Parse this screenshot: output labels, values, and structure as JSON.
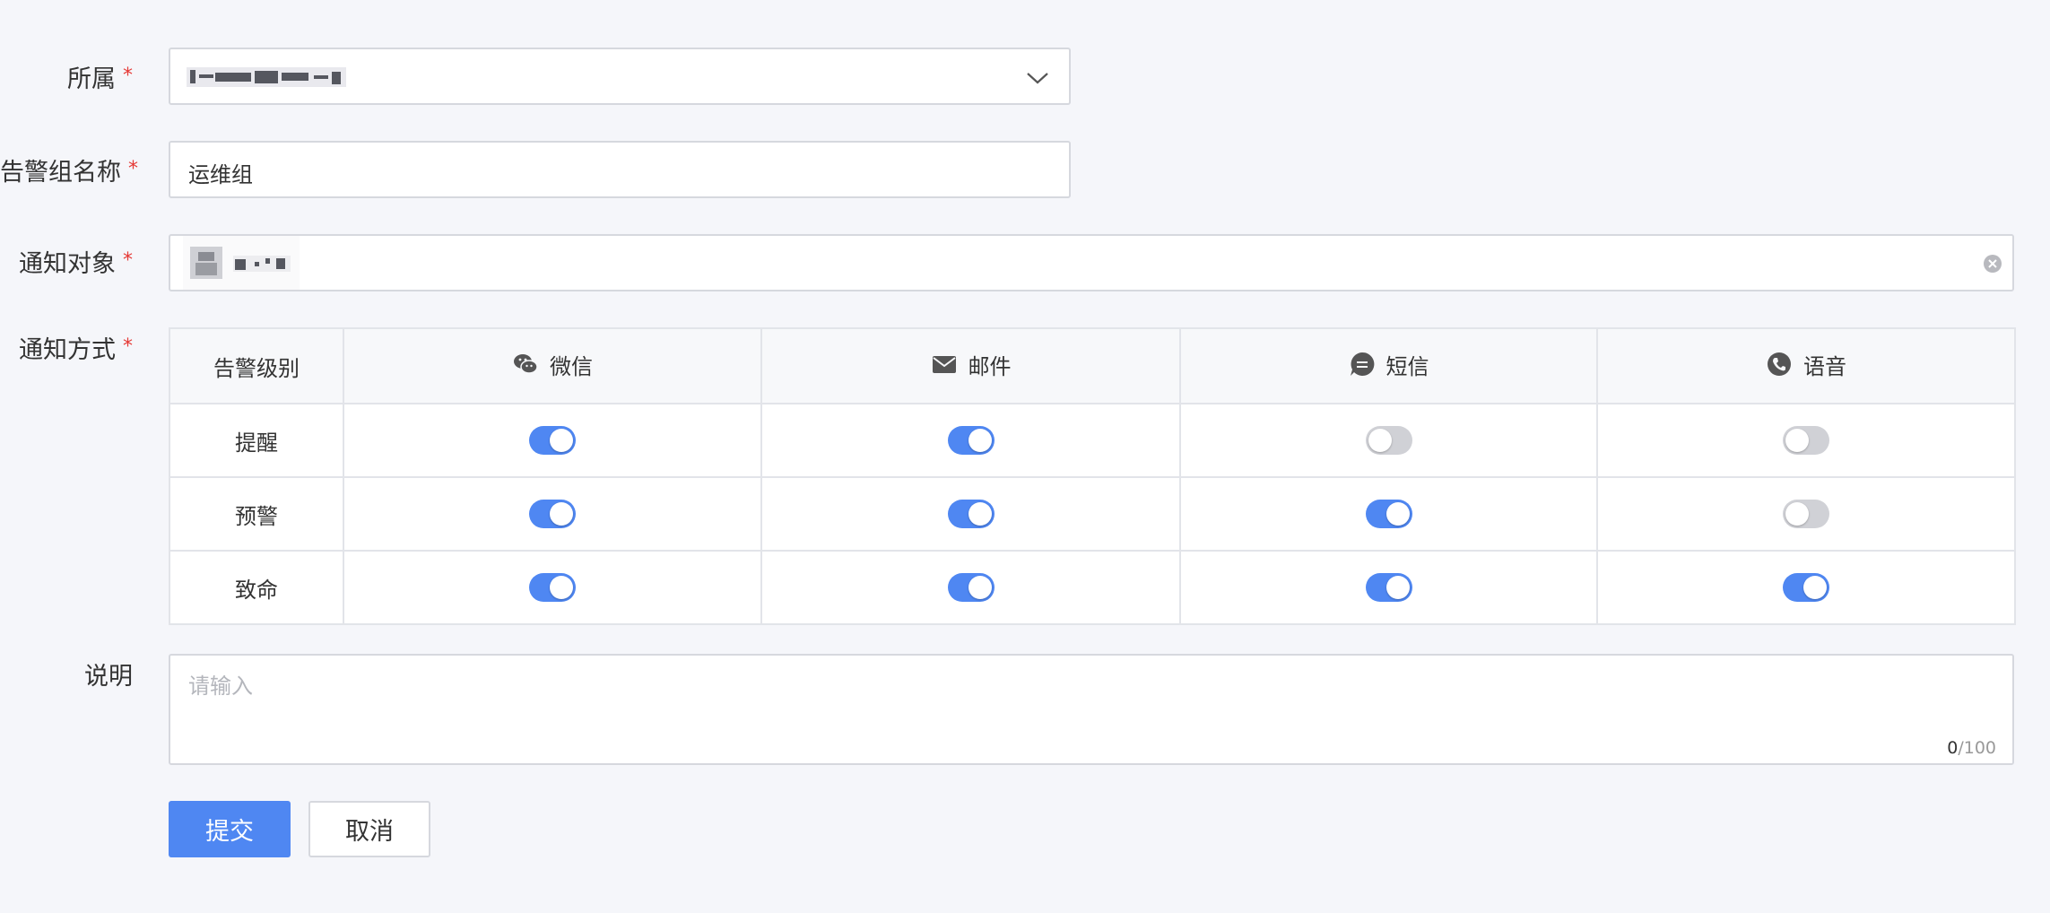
{
  "form": {
    "owner": {
      "label": "所属",
      "required_mark": "*"
    },
    "group_name": {
      "label": "告警组名称",
      "required_mark": "*",
      "value": "运维组"
    },
    "notify_target": {
      "label": "通知对象",
      "required_mark": "*"
    },
    "notify_method": {
      "label": "通知方式",
      "required_mark": "*"
    },
    "description": {
      "label": "说明",
      "placeholder": "请输入",
      "count_current": "0",
      "count_max": "/100"
    }
  },
  "matrix": {
    "level_header": "告警级别",
    "channels": [
      {
        "label": "微信",
        "icon": "wechat-icon"
      },
      {
        "label": "邮件",
        "icon": "mail-icon"
      },
      {
        "label": "短信",
        "icon": "sms-icon"
      },
      {
        "label": "语音",
        "icon": "voice-call-icon"
      }
    ],
    "rows": [
      {
        "level": "提醒",
        "enabled": [
          true,
          true,
          false,
          false
        ]
      },
      {
        "level": "预警",
        "enabled": [
          true,
          true,
          true,
          false
        ]
      },
      {
        "level": "致命",
        "enabled": [
          true,
          true,
          true,
          true
        ]
      }
    ]
  },
  "actions": {
    "submit_label": "提交",
    "cancel_label": "取消"
  },
  "colors": {
    "accent": "#4f87f2",
    "switch_off": "#d0d1d6",
    "required": "#e53935"
  }
}
